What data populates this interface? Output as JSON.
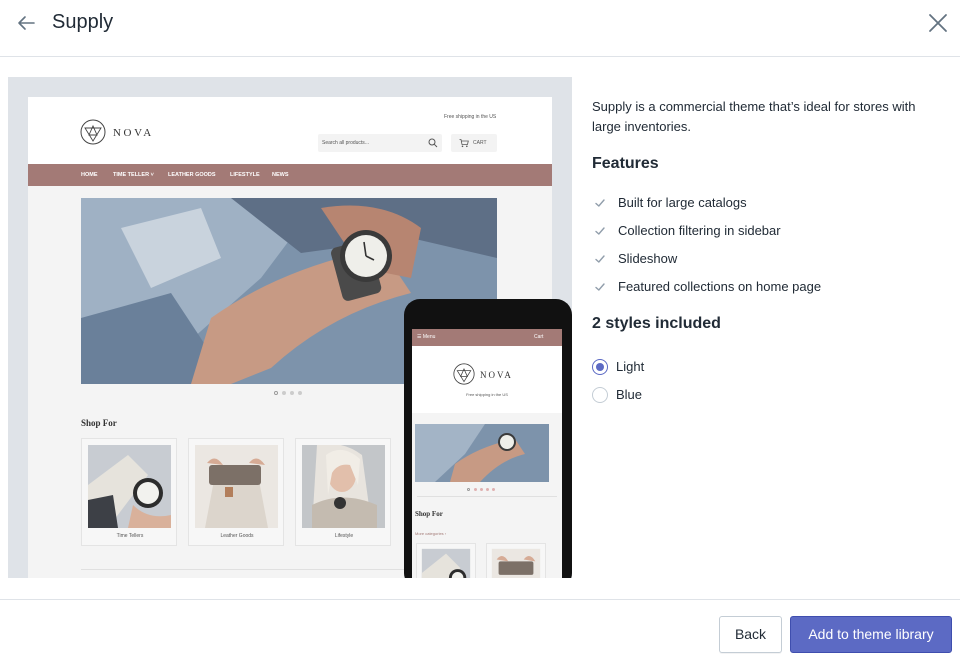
{
  "header": {
    "title": "Supply",
    "back_icon": "arrow-left-icon",
    "close_icon": "close-icon"
  },
  "preview": {
    "desktop": {
      "logo_text": "NOVA",
      "shipping_note": "Free shipping in the US",
      "search_placeholder": "Search all products...",
      "cart_label": "CART",
      "nav": [
        "HOME",
        "TIME TELLER ˅",
        "LEATHER GOODS",
        "LIFESTYLE",
        "NEWS"
      ],
      "shop_for": "Shop For",
      "categories": [
        "Time Tellers",
        "Leather Goods",
        "Lifestyle"
      ]
    },
    "mobile": {
      "menu_label": "☰ Menu",
      "cart_label": "Cart",
      "logo_text": "NOVA",
      "shipping_note": "Free shipping in the US",
      "shop_for": "Shop For",
      "more_categories": "More categories ›"
    }
  },
  "info": {
    "description": "Supply is a commercial theme that’s ideal for stores with large inventories.",
    "features_heading": "Features",
    "features": [
      "Built for large catalogs",
      "Collection filtering in sidebar",
      "Slideshow",
      "Featured collections on home page"
    ],
    "styles_heading": "2 styles included",
    "styles": [
      {
        "label": "Light",
        "selected": true
      },
      {
        "label": "Blue",
        "selected": false
      }
    ]
  },
  "footer": {
    "back_label": "Back",
    "add_label": "Add to theme library"
  },
  "colors": {
    "accent": "#5c6ac4",
    "theme_nav": "#a37a76",
    "preview_bg": "#dfe3e8",
    "text": "#212b36"
  }
}
